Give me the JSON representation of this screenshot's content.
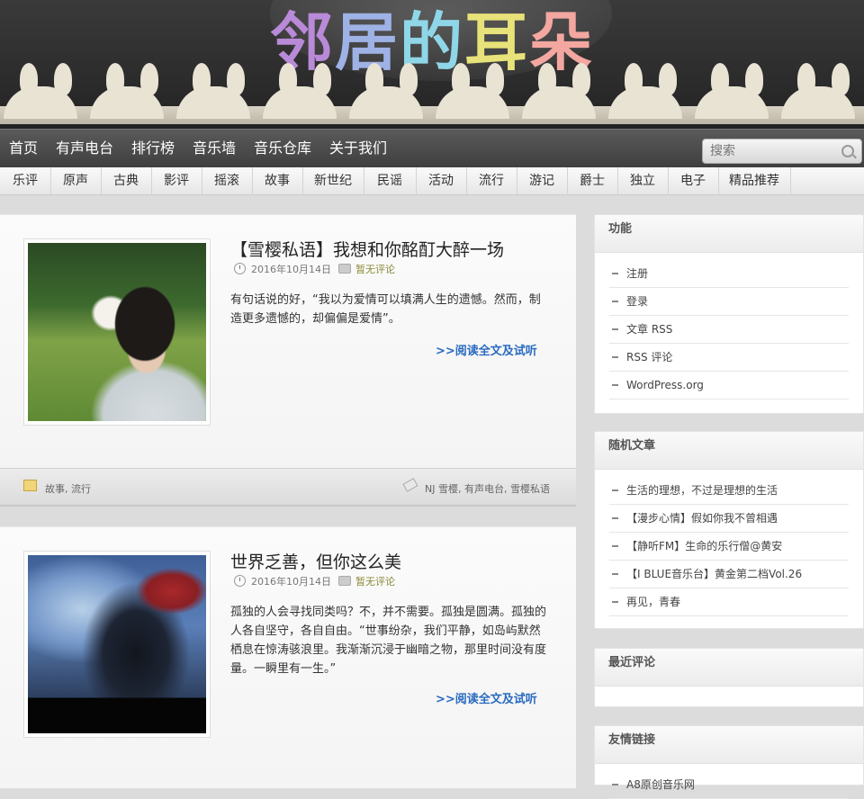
{
  "site": {
    "logo_chars": [
      {
        "ch": "邻",
        "color": "#b98ad8"
      },
      {
        "ch": "居",
        "color": "#9fb2e6"
      },
      {
        "ch": "的",
        "color": "#8fd6e8"
      },
      {
        "ch": "耳",
        "color": "#e8e27a"
      },
      {
        "ch": "朵",
        "color": "#f3a7a0"
      }
    ]
  },
  "main_nav": [
    "首页",
    "有声电台",
    "排行榜",
    "音乐墙",
    "音乐仓库",
    "关于我们"
  ],
  "search": {
    "placeholder": "搜索"
  },
  "categories": [
    "乐评",
    "原声",
    "古典",
    "影评",
    "摇滚",
    "故事",
    "新世纪",
    "民谣",
    "活动",
    "流行",
    "游记",
    "爵士",
    "独立",
    "电子",
    "精品推荐"
  ],
  "posts": [
    {
      "title": "【雪樱私语】我想和你酩酊大醉一场",
      "date": "2016年10月14日",
      "comments": "暂无评论",
      "excerpt": "有句话说的好，“我以为爱情可以填满人生的遗憾。然而，制造更多遗憾的，却偏偏是爱情”。",
      "more": ">>阅读全文及试听",
      "categories": "故事, 流行",
      "tags": "NJ 雪樱, 有声电台, 雪樱私语"
    },
    {
      "title": "世界乏善，但你这么美",
      "date": "2016年10月14日",
      "comments": "暂无评论",
      "excerpt": "孤独的人会寻找同类吗？不，并不需要。孤独是圆满。孤独的人各自坚守，各自自由。“世事纷杂，我们平静，如岛屿默然栖息在惊涛骇浪里。我渐渐沉浸于幽暗之物，那里时间没有度量。一瞬里有一生。”",
      "more": ">>阅读全文及试听"
    }
  ],
  "sidebar": {
    "functions": {
      "title": "功能",
      "items": [
        "注册",
        "登录",
        "文章 RSS",
        "RSS 评论",
        "WordPress.org"
      ]
    },
    "random": {
      "title": "随机文章",
      "items": [
        "生活的理想，不过是理想的生活",
        "【漫步心情】假如你我不曾相遇",
        "【静听FM】生命的乐行僧@黄安",
        "【I BLUE音乐台】黄金第二档Vol.26",
        "再见，青春"
      ]
    },
    "recent_comments": {
      "title": "最近评论"
    },
    "links": {
      "title": "友情链接",
      "items": [
        "A8原创音乐网"
      ]
    }
  }
}
